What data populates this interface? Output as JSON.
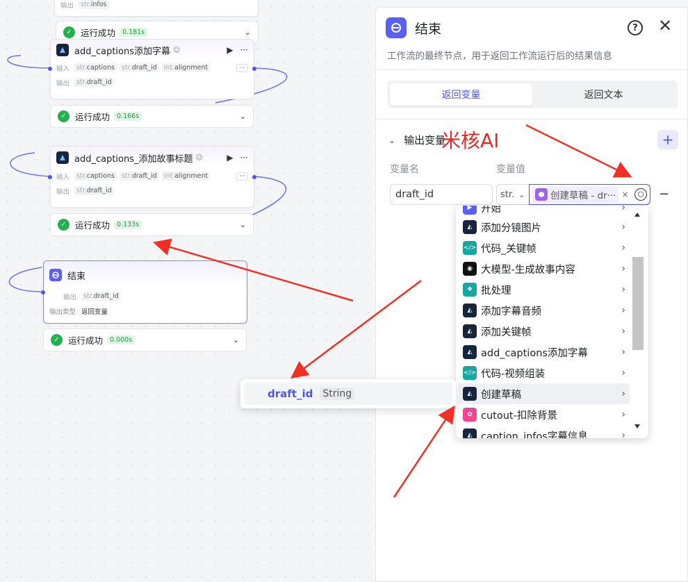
{
  "canvas": {
    "top_output": {
      "label": "输出",
      "type": "str.",
      "name": "infos"
    },
    "nodes": [
      {
        "title": "add_captions添加字幕",
        "inputs": [
          {
            "type": "str.",
            "name": "captions"
          },
          {
            "type": "str.",
            "name": "draft_id"
          },
          {
            "type": "int.",
            "name": "alignment"
          }
        ],
        "output": {
          "type": "str.",
          "name": "draft_id"
        },
        "run": {
          "label": "运行成功",
          "time": "0.166s"
        }
      },
      {
        "title": "add_captions_添加故事标题",
        "inputs": [
          {
            "type": "str.",
            "name": "captions"
          },
          {
            "type": "str.",
            "name": "draft_id"
          },
          {
            "type": "int.",
            "name": "alignment"
          }
        ],
        "output": {
          "type": "str.",
          "name": "draft_id"
        },
        "run": {
          "label": "运行成功",
          "time": "0.133s"
        }
      }
    ],
    "top_run": {
      "label": "运行成功",
      "time": "0.181s"
    },
    "input_label": "输入",
    "output_label": "输出",
    "more_label": "···",
    "end_node": {
      "title": "结束",
      "output_label": "输出",
      "output": {
        "type": "str.",
        "name": "draft_id"
      },
      "type_label": "输出类型",
      "type_value": "返回变量",
      "run": {
        "label": "运行成功",
        "time": "0.000s"
      }
    }
  },
  "panel": {
    "title": "结束",
    "description": "工作流的最终节点，用于返回工作流运行后的结果信息",
    "tabs": [
      "返回变量",
      "返回文本"
    ],
    "section_title": "输出变量",
    "watermark": "米核AI",
    "col_name": "变量名",
    "col_value": "变量值",
    "var_name": "draft_id",
    "var_type": "str.",
    "ref_label": "创建草稿 - dr···"
  },
  "dropdown": {
    "items": [
      {
        "label": "开始",
        "icon": "start-icon",
        "color": "#5b5ff2"
      },
      {
        "label": "添加分镜图片",
        "icon": "plugin-icon",
        "color": "#15253b"
      },
      {
        "label": "代码_关键帧",
        "icon": "code-icon",
        "color": "#1aa6a0"
      },
      {
        "label": "大模型-生成故事内容",
        "icon": "llm-icon",
        "color": "#111111"
      },
      {
        "label": "批处理",
        "icon": "batch-icon",
        "color": "#1aa6a0"
      },
      {
        "label": "添加字幕音频",
        "icon": "plugin-icon",
        "color": "#15253b"
      },
      {
        "label": "添加关键帧",
        "icon": "plugin-icon",
        "color": "#15253b"
      },
      {
        "label": "add_captions添加字幕",
        "icon": "plugin-icon",
        "color": "#15253b"
      },
      {
        "label": "代码-视频组装",
        "icon": "code-icon",
        "color": "#1aa6a0"
      },
      {
        "label": "创建草稿",
        "icon": "plugin-icon",
        "color": "#15253b",
        "highlighted": true
      },
      {
        "label": "cutout-扣除背景",
        "icon": "cutout-icon",
        "color": "#f0468f"
      },
      {
        "label": "caption_infos字幕信息",
        "icon": "plugin-icon",
        "color": "#15253b"
      }
    ]
  },
  "popup": {
    "name": "draft_id",
    "type": "String"
  },
  "annotation_color": "#ee3124",
  "accent_color": "#4e55e8"
}
